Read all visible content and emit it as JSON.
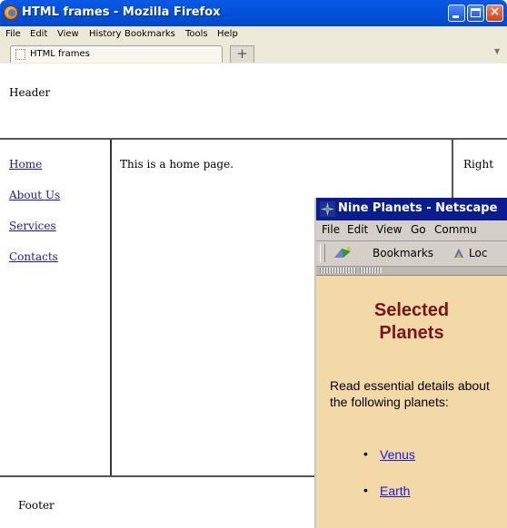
{
  "window": {
    "title": "HTML frames - Mozilla Firefox",
    "close_glyph": "×"
  },
  "menubar": [
    "File",
    "Edit",
    "View",
    "History",
    "Bookmarks",
    "Tools",
    "Help"
  ],
  "tab": {
    "label": "HTML frames",
    "new_tab_glyph": "+"
  },
  "frames": {
    "header": "Header",
    "nav": [
      "Home",
      "About Us",
      "Services",
      "Contacts"
    ],
    "main": "This is a home page.",
    "right": "Right",
    "footer": "Footer"
  },
  "netscape": {
    "title": "Nine Planets - Netscape",
    "menu": [
      "File",
      "Edit",
      "View",
      "Go",
      "Commu"
    ],
    "toolbar": {
      "bookmarks": "Bookmarks",
      "location": "Loc"
    },
    "heading": "Selected Planets",
    "intro": "Read essential details about the following planets:",
    "links": [
      "Venus",
      "Earth"
    ]
  },
  "colors": {
    "titlebar": "#0052de",
    "chrome": "#ece9d8",
    "link": "#1a1aa6",
    "netscape_bg": "#f3d9a8",
    "netscape_heading": "#7a1418"
  }
}
